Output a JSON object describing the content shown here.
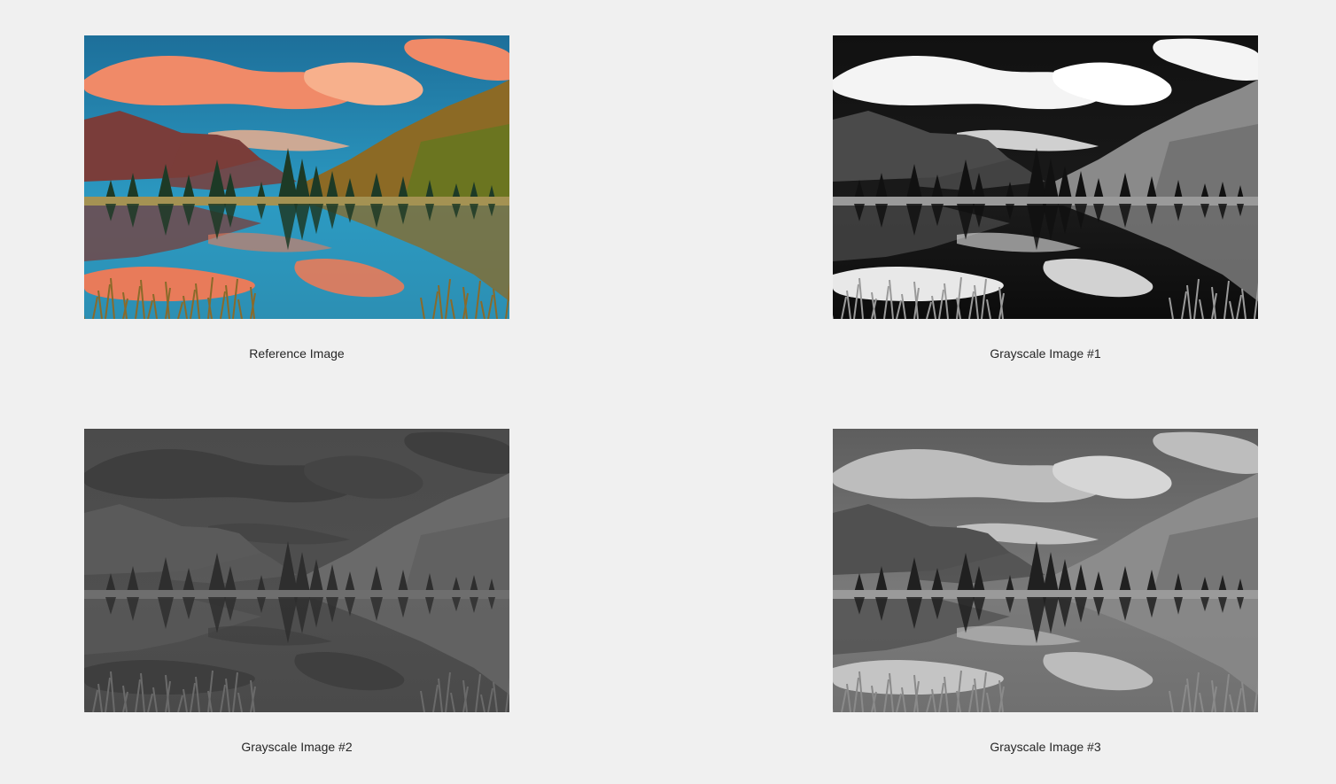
{
  "figure": {
    "background": "#f0f0f0",
    "panels": [
      {
        "caption": "Reference Image",
        "mode": "color",
        "palette": {
          "sky_top": "#1d6f9a",
          "sky_mid": "#2c9ac2",
          "cloud": "#f08a68",
          "cloud_light": "#f7b08c",
          "mountain_left": "#7a3d3a",
          "mountain_right": "#8c6a25",
          "hill_green": "#5d7a1e",
          "trees": "#1d3a26",
          "shore": "#a49253",
          "water": "#2c8fb3",
          "water_reflect": "#e87b5a",
          "grass": "#8a6a2a"
        }
      },
      {
        "caption": "Grayscale Image #1",
        "mode": "high-contrast",
        "palette": {
          "sky_top": "#111111",
          "sky_mid": "#1a1a1a",
          "cloud": "#f4f4f4",
          "cloud_light": "#ffffff",
          "mountain_left": "#4a4a4a",
          "mountain_right": "#8a8a8a",
          "hill_green": "#6a6a6a",
          "trees": "#111111",
          "shore": "#9a9a9a",
          "water": "#0c0c0c",
          "water_reflect": "#e8e8e8",
          "grass": "#9a9a9a"
        }
      },
      {
        "caption": "Grayscale Image #2",
        "mode": "low-contrast",
        "palette": {
          "sky_top": "#4b4b4b",
          "sky_mid": "#4f4f4f",
          "cloud": "#3e3e3e",
          "cloud_light": "#444444",
          "mountain_left": "#5a5a5a",
          "mountain_right": "#6a6a6a",
          "hill_green": "#5e5e5e",
          "trees": "#2e2e2e",
          "shore": "#6e6e6e",
          "water": "#4a4a4a",
          "water_reflect": "#3e3e3e",
          "grass": "#6a6a6a"
        }
      },
      {
        "caption": "Grayscale Image #3",
        "mode": "luminance",
        "palette": {
          "sky_top": "#5e5e5e",
          "sky_mid": "#7a7a7a",
          "cloud": "#bdbdbd",
          "cloud_light": "#d6d6d6",
          "mountain_left": "#505050",
          "mountain_right": "#8c8c8c",
          "hill_green": "#6c6c6c",
          "trees": "#202020",
          "shore": "#9a9a9a",
          "water": "#707070",
          "water_reflect": "#c4c4c4",
          "grass": "#8a8a8a"
        }
      }
    ]
  }
}
